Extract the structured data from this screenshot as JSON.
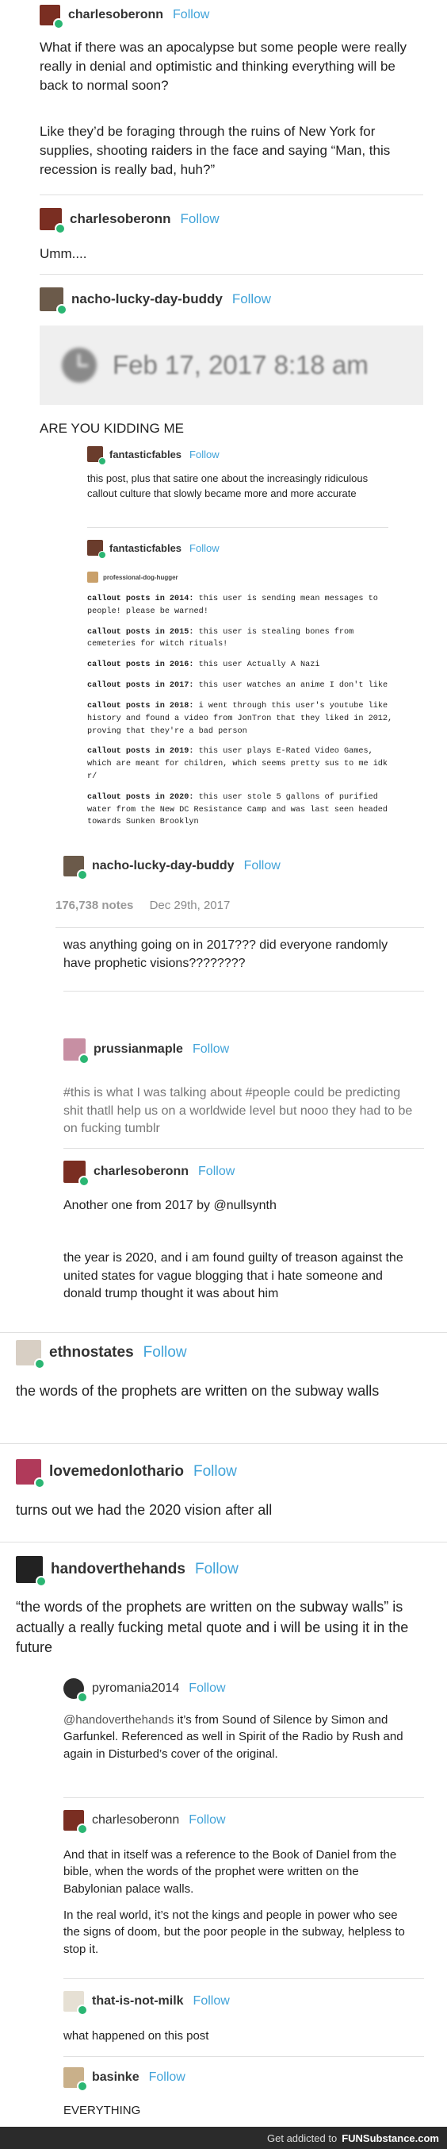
{
  "post1": {
    "user": "charlesoberonn",
    "follow": "Follow",
    "p1": "What if there was an apocalypse but some people were really really in denial and optimistic and thinking everything will be back to normal soon?",
    "p2": "Like they’d be foraging through the ruins of New York for supplies, shooting raiders in the face and saying “Man, this recession is really bad, huh?”"
  },
  "post2": {
    "user": "charlesoberonn",
    "follow": "Follow",
    "text": "Umm...."
  },
  "post3": {
    "user": "nacho-lucky-day-buddy",
    "follow": "Follow",
    "timestamp": "Feb 17, 2017 8:18 am",
    "text": "ARE YOU KIDDING ME"
  },
  "nested": {
    "ff1_user": "fantasticfables",
    "ff1_follow": "Follow",
    "ff1_text": "this post, plus that satire one about the increasingly ridiculous callout culture that slowly became more and more accurate",
    "ff2_user": "fantasticfables",
    "ff2_follow": "Follow",
    "pdh_user": "professional-dog-hugger",
    "callouts": [
      {
        "label": "callout posts in 2014:",
        "text": "this user is sending mean messages to people! please be warned!"
      },
      {
        "label": "callout posts in 2015:",
        "text": "this user is stealing bones from cemeteries for witch rituals!"
      },
      {
        "label": "callout posts in 2016:",
        "text": "this user Actually A Nazi"
      },
      {
        "label": "callout posts in 2017:",
        "text": "this user watches an anime I don't like"
      },
      {
        "label": "callout posts in 2018:",
        "text": "i went through this user's youtube like history and found a video from JonTron that they liked in 2012, proving that they're a bad person"
      },
      {
        "label": "callout posts in 2019:",
        "text": "this user plays E-Rated Video Games, which are meant for children, which seems pretty sus to me idk r/"
      },
      {
        "label": "callout posts in 2020:",
        "text": "this user stole 5 gallons of purified water from the New DC Resistance Camp and was last seen headed towards Sunken Brooklyn"
      }
    ],
    "nacho_user": "nacho-lucky-day-buddy",
    "nacho_follow": "Follow",
    "notes": "176,738 notes",
    "date": "Dec 29th, 2017"
  },
  "post4": {
    "text": "was anything going on in 2017??? did everyone randomly have prophetic visions????????"
  },
  "post5": {
    "user": "prussianmaple",
    "follow": "Follow",
    "tags": "#this is what I was talking about  #people could be predicting shit thatll help us on a worldwide level but nooo they had to be on fucking tumblr"
  },
  "post6": {
    "user": "charlesoberonn",
    "follow": "Follow",
    "p1": "Another one from 2017 by @nullsynth",
    "p2": "the year is 2020, and i am found guilty of treason against the united states for vague blogging that i hate someone and donald trump thought it was about him"
  },
  "post7": {
    "user": "ethnostates",
    "follow": "Follow",
    "text": "the words of the prophets are written on the subway walls"
  },
  "post8": {
    "user": "lovemedonlothario",
    "follow": "Follow",
    "text": "turns out we had the 2020 vision after all"
  },
  "post9": {
    "user": "handoverthehands",
    "follow": "Follow",
    "text": "“the words of the prophets are written on the subway walls” is actually a really fucking metal quote and i will be using it in the future"
  },
  "post10": {
    "user": "pyromania2014",
    "follow": "Follow",
    "mention": "@handoverthehands",
    "text": " it’s from Sound of Silence by Simon and Garfunkel. Referenced as well in Spirit of the Radio by Rush and again in Disturbed’s cover of the original."
  },
  "post11": {
    "user": "charlesoberonn",
    "follow": "Follow",
    "p1": "And that in itself was a reference to the Book of Daniel from the bible, when the words of the prophet were written on the Babylonian palace walls.",
    "p2": "In the real world, it’s not the kings and people in power who see the signs of doom, but the poor people in the subway, helpless to stop it."
  },
  "post12": {
    "user": "that-is-not-milk",
    "follow": "Follow",
    "text": "what happened on this post"
  },
  "post13": {
    "user": "basinke",
    "follow": "Follow",
    "text": "EVERYTHING"
  },
  "footer": {
    "prefix": "Get addicted to",
    "brand": "FUNSubstance.com"
  },
  "colors": {
    "follow": "#41a3d9",
    "badge": "#2bb673",
    "footer_bg": "#2b2b2b"
  }
}
